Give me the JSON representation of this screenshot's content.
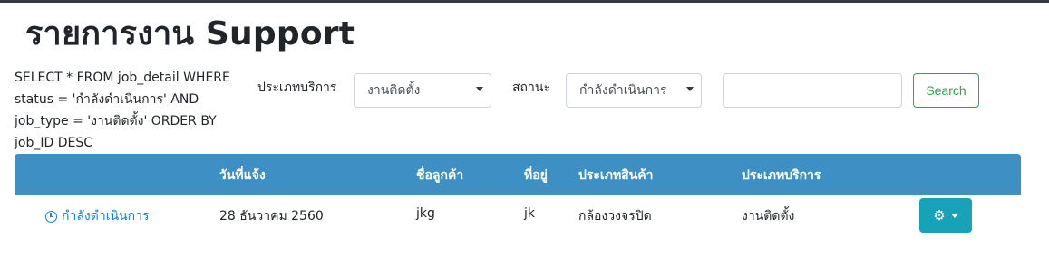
{
  "page": {
    "title": "รายการงาน Support",
    "sql_query": "SELECT * FROM job_detail WHERE status = 'กำลังดำเนินการ' AND job_type = 'งานติดตั้ง' ORDER BY job_ID DESC"
  },
  "filters": {
    "service_type_label": "ประเภทบริการ",
    "service_type_value": "งานติดตั้ง",
    "status_label": "สถานะ",
    "status_value": "กำลังดำเนินการ",
    "search_value": "",
    "search_button": "Search"
  },
  "table": {
    "headers": [
      "",
      "วันที่แจ้ง",
      "ชื่อลูกค้า",
      "ที่อยู่",
      "ประเภทสินค้า",
      "ประเภทบริการ",
      ""
    ],
    "rows": [
      {
        "status": "กำลังดำเนินการ",
        "status_icon": "clock-icon",
        "date": "28 ธันวาคม 2560",
        "customer": "jkg",
        "address": "jk",
        "product_type": "กล้องวงจรปิด",
        "service_type": "งานติดตั้ง",
        "action_icon": "gear-icon"
      }
    ]
  },
  "colors": {
    "header_bg": "#3e8fc4",
    "link": "#1a7fd8",
    "search_button": "#28a745",
    "action_button": "#17a2b8"
  }
}
